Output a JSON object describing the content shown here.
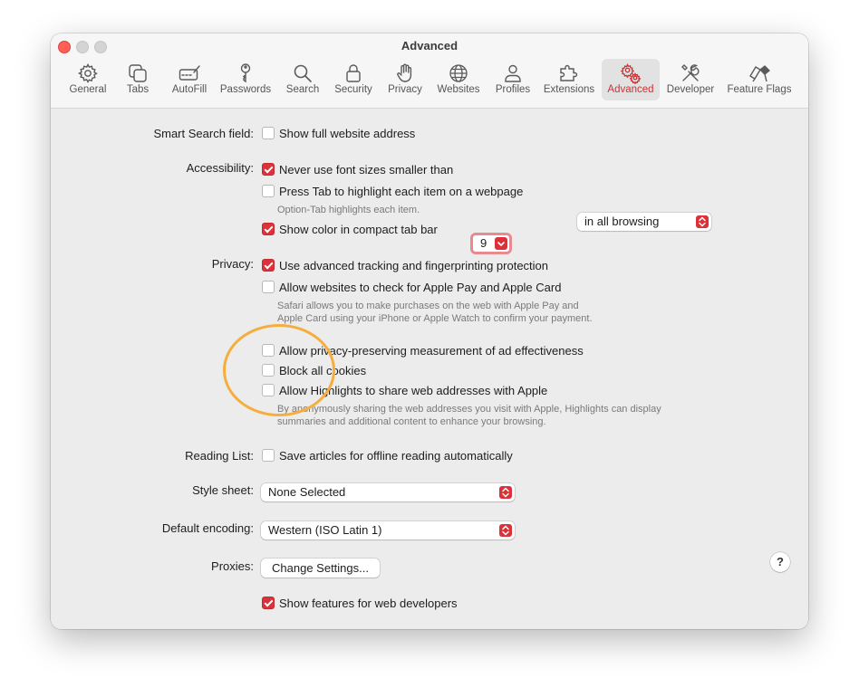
{
  "window": {
    "title": "Advanced"
  },
  "toolbar": [
    {
      "label": "General",
      "icon": "gear-icon"
    },
    {
      "label": "Tabs",
      "icon": "tabs-icon"
    },
    {
      "label": "AutoFill",
      "icon": "autofill-icon"
    },
    {
      "label": "Passwords",
      "icon": "key-icon"
    },
    {
      "label": "Search",
      "icon": "search-icon"
    },
    {
      "label": "Security",
      "icon": "lock-icon"
    },
    {
      "label": "Privacy",
      "icon": "hand-icon"
    },
    {
      "label": "Websites",
      "icon": "globe-icon"
    },
    {
      "label": "Profiles",
      "icon": "person-icon"
    },
    {
      "label": "Extensions",
      "icon": "puzzle-icon"
    },
    {
      "label": "Advanced",
      "icon": "gears-icon",
      "active": true
    },
    {
      "label": "Developer",
      "icon": "tools-icon"
    },
    {
      "label": "Feature Flags",
      "icon": "flags-icon"
    }
  ],
  "smart_search": {
    "label": "Smart Search field:",
    "show_full_address": {
      "text": "Show full website address",
      "checked": false
    }
  },
  "accessibility": {
    "label": "Accessibility:",
    "never_font_smaller": {
      "text": "Never use font sizes smaller than",
      "checked": true,
      "value": "9"
    },
    "press_tab": {
      "text": "Press Tab to highlight each item on a webpage",
      "checked": false
    },
    "press_tab_note": "Option-Tab highlights each item.",
    "show_color": {
      "text": "Show color in compact tab bar",
      "checked": true
    }
  },
  "privacy": {
    "label": "Privacy:",
    "tracking": {
      "text": "Use advanced tracking and fingerprinting protection",
      "checked": true,
      "selected": "in all browsing"
    },
    "apple_pay": {
      "text": "Allow websites to check for Apple Pay and Apple Card",
      "checked": false
    },
    "apple_pay_note": "Safari allows you to make purchases on the web with Apple Pay and Apple Card using your iPhone or Apple Watch to confirm your payment.",
    "ad_measurement": {
      "text": "Allow privacy-preserving measurement of ad effectiveness",
      "checked": false
    },
    "block_cookies": {
      "text": "Block all cookies",
      "checked": false
    },
    "highlights": {
      "text": "Allow Highlights to share web addresses with Apple",
      "checked": false
    },
    "highlights_note": "By anonymously sharing the web addresses you visit with Apple, Highlights can display summaries and additional content to enhance your browsing."
  },
  "reading_list": {
    "label": "Reading List:",
    "offline": {
      "text": "Save articles for offline reading automatically",
      "checked": false
    }
  },
  "style_sheet": {
    "label": "Style sheet:",
    "selected": "None Selected"
  },
  "encoding": {
    "label": "Default encoding:",
    "selected": "Western (ISO Latin 1)"
  },
  "proxies": {
    "label": "Proxies:",
    "button": "Change Settings..."
  },
  "developer": {
    "show_features": {
      "text": "Show features for web developers",
      "checked": true
    }
  },
  "help": {
    "label": "?"
  },
  "colors": {
    "accent": "#dc3138",
    "annotation": "#f6ad3c"
  }
}
